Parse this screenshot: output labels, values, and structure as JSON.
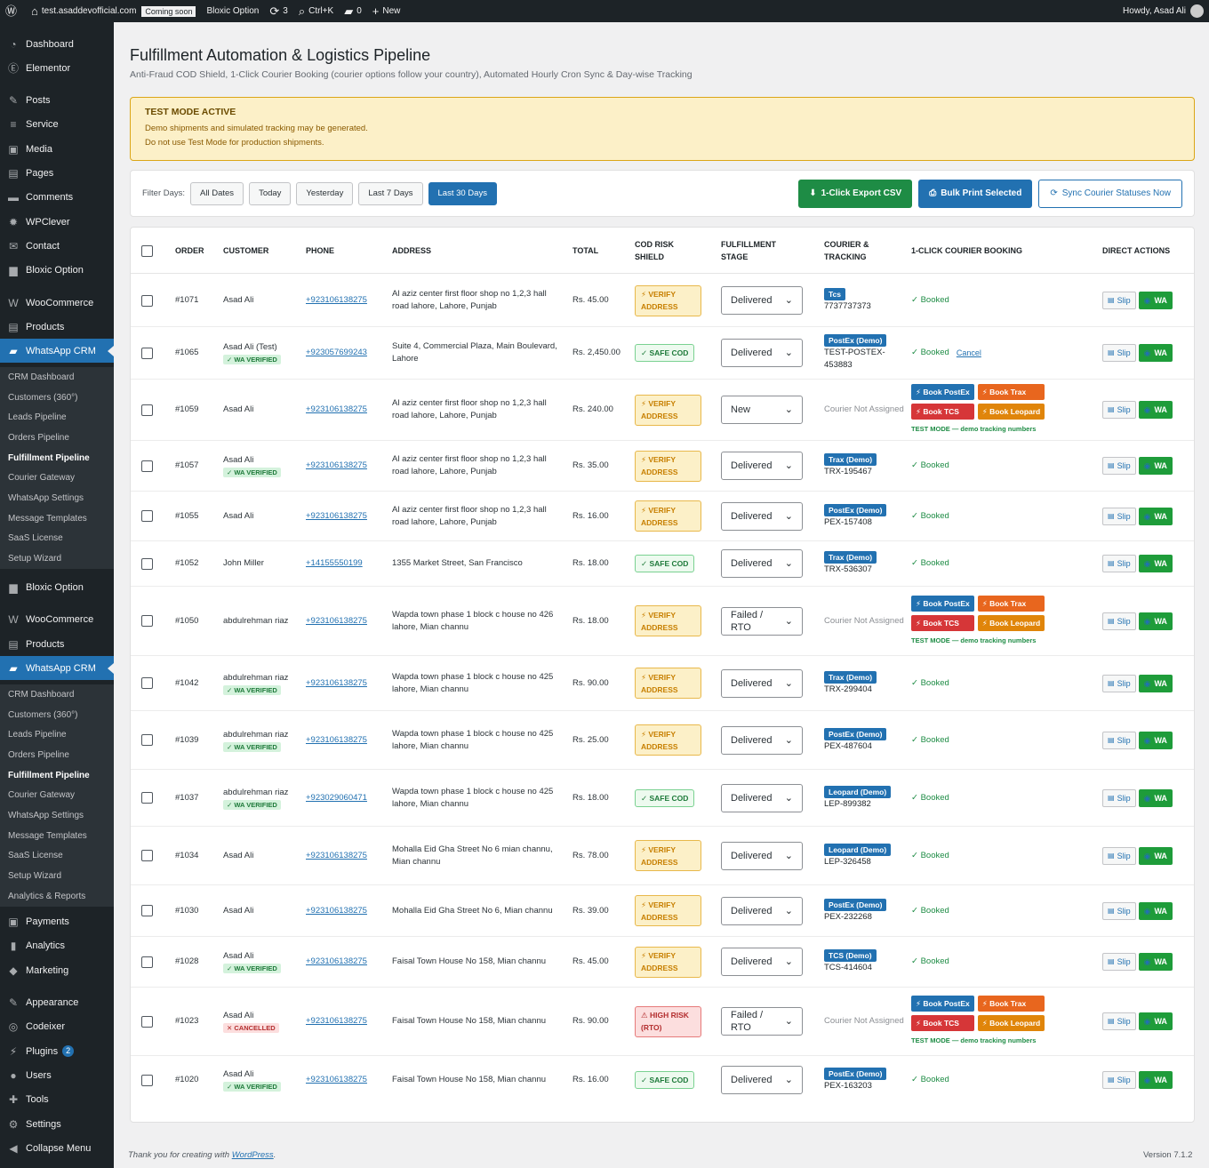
{
  "adminbar": {
    "site": "test.asaddevofficial.com",
    "coming": "Coming soon",
    "plugin": "Bloxic Option",
    "updates": "3",
    "shortcut": "Ctrl+K",
    "comments": "0",
    "new": "New",
    "howdy": "Howdy, Asad Ali"
  },
  "menu": {
    "items": [
      {
        "label": "Dashboard",
        "icon": "dashboard-icon",
        "glyph": "◔"
      },
      {
        "label": "Elementor",
        "icon": "elementor-icon",
        "glyph": "Ⓔ"
      },
      {
        "label": "Posts",
        "icon": "pin-icon",
        "glyph": "✎"
      },
      {
        "label": "Service",
        "icon": "list-icon",
        "glyph": "≡"
      },
      {
        "label": "Media",
        "icon": "media-icon",
        "glyph": "▣"
      },
      {
        "label": "Pages",
        "icon": "pages-icon",
        "glyph": "▤"
      },
      {
        "label": "Comments",
        "icon": "comment-icon",
        "glyph": "▬"
      },
      {
        "label": "WPClever",
        "icon": "gear-icon",
        "glyph": "✹"
      },
      {
        "label": "Contact",
        "icon": "mail-icon",
        "glyph": "✉"
      },
      {
        "label": "Bloxic Option",
        "icon": "folder-icon",
        "glyph": "▆"
      },
      {
        "label": "WooCommerce",
        "icon": "woo-icon",
        "glyph": "W"
      },
      {
        "label": "Products",
        "icon": "archive-icon",
        "glyph": "▤"
      },
      {
        "label": "WhatsApp CRM",
        "icon": "chat-icon",
        "glyph": "▰"
      },
      {
        "label": "Bloxic Option",
        "icon": "folder-icon",
        "glyph": "▆"
      },
      {
        "label": "WooCommerce",
        "icon": "woo-icon",
        "glyph": "W"
      },
      {
        "label": "Products",
        "icon": "archive-icon",
        "glyph": "▤"
      },
      {
        "label": "WhatsApp CRM",
        "icon": "chat-icon",
        "glyph": "▰"
      },
      {
        "label": "Payments",
        "icon": "payments-icon",
        "glyph": "▣"
      },
      {
        "label": "Analytics",
        "icon": "analytics-icon",
        "glyph": "▮"
      },
      {
        "label": "Marketing",
        "icon": "megaphone-icon",
        "glyph": "◆"
      },
      {
        "label": "Appearance",
        "icon": "brush-icon",
        "glyph": "✎"
      },
      {
        "label": "Codeixer",
        "icon": "codeixer-icon",
        "glyph": "◎"
      },
      {
        "label": "Plugins",
        "icon": "plugin-icon",
        "glyph": "⚡",
        "badge": "2"
      },
      {
        "label": "Users",
        "icon": "user-icon",
        "glyph": "●"
      },
      {
        "label": "Tools",
        "icon": "wrench-icon",
        "glyph": "✚"
      },
      {
        "label": "Settings",
        "icon": "settings-icon",
        "glyph": "⚙"
      },
      {
        "label": "Collapse Menu",
        "icon": "collapse-icon",
        "glyph": "◀"
      }
    ],
    "sub1": [
      "CRM Dashboard",
      "Customers (360°)",
      "Leads Pipeline",
      "Orders Pipeline",
      "Fulfillment Pipeline",
      "Courier Gateway",
      "WhatsApp Settings",
      "Message Templates",
      "SaaS License",
      "Setup Wizard"
    ],
    "sub2": [
      "CRM Dashboard",
      "Customers (360°)",
      "Leads Pipeline",
      "Orders Pipeline",
      "Fulfillment Pipeline",
      "Courier Gateway",
      "WhatsApp Settings",
      "Message Templates",
      "SaaS License",
      "Setup Wizard",
      "Analytics & Reports"
    ]
  },
  "page": {
    "title": "Fulfillment Automation & Logistics Pipeline",
    "subtitle": "Anti-Fraud COD Shield, 1-Click Courier Booking (courier options follow your country), Automated Hourly Cron Sync & Day-wise Tracking"
  },
  "notice": {
    "title": "TEST MODE ACTIVE",
    "line1": "Demo shipments and simulated tracking may be generated.",
    "line2": "Do not use Test Mode for production shipments."
  },
  "filters": {
    "label": "Filter Days:",
    "options": [
      "All Dates",
      "Today",
      "Yesterday",
      "Last 7 Days",
      "Last 30 Days"
    ],
    "active": "Last 30 Days"
  },
  "actions": {
    "export": "1-Click Export CSV",
    "print": "Bulk Print Selected",
    "sync": "Sync Courier Statuses Now"
  },
  "table": {
    "headers": {
      "order": "ORDER",
      "customer": "CUSTOMER",
      "phone": "PHONE",
      "address": "ADDRESS",
      "total": "TOTAL",
      "risk1": "COD RISK",
      "risk2": "SHIELD",
      "stage1": "FULFILLMENT",
      "stage2": "STAGE",
      "courier1": "COURIER &",
      "courier2": "TRACKING",
      "booking": "1-CLICK COURIER BOOKING",
      "actions": "DIRECT ACTIONS"
    },
    "labels": {
      "verified": "✓ WA VERIFIED",
      "cancelled": "✕ CANCELLED",
      "booked": "✓ Booked",
      "cancel": "Cancel",
      "not_assigned": "Courier Not Assigned",
      "postex": "⚡ Book PostEx",
      "trax": "⚡ Book Trax",
      "tcs": "⚡ Book TCS",
      "leopard": "⚡ Book Leopard",
      "testmode": "TEST MODE — demo tracking numbers",
      "slip": "Slip",
      "wa": "WA"
    },
    "rows": [
      {
        "order": "#1071",
        "customer": "Asad Ali",
        "badge": "",
        "phone": "+923106138275",
        "address": "Al aziz center first floor shop no 1,2,3 hall road lahore, Lahore, Punjab",
        "total": "Rs. 45.00",
        "risk": "verify",
        "risk_text": "⚡ VERIFY ADDRESS",
        "stage": "Delivered",
        "courier": "Tcs",
        "tracking": "7737737373",
        "booking": "booked"
      },
      {
        "order": "#1065",
        "customer": "Asad Ali (Test)",
        "badge": "verified",
        "phone": "+923057699243",
        "address": "Suite 4, Commercial Plaza, Main Boulevard, Lahore",
        "total": "Rs. 2,450.00",
        "risk": "safe",
        "risk_text": "✓ SAFE COD",
        "stage": "Delivered",
        "courier": "PostEx (Demo)",
        "tracking": "TEST-POSTEX-453883",
        "booking": "booked_cancel"
      },
      {
        "order": "#1059",
        "customer": "Asad Ali",
        "badge": "",
        "phone": "+923106138275",
        "address": "Al aziz center first floor shop no 1,2,3 hall road lahore, Lahore, Punjab",
        "total": "Rs. 240.00",
        "risk": "verify",
        "risk_text": "⚡ VERIFY ADDRESS",
        "stage": "New",
        "courier": "",
        "tracking": "",
        "booking": "book"
      },
      {
        "order": "#1057",
        "customer": "Asad Ali",
        "badge": "verified",
        "phone": "+923106138275",
        "address": "Al aziz center first floor shop no 1,2,3 hall road lahore, Lahore, Punjab",
        "total": "Rs. 35.00",
        "risk": "verify",
        "risk_text": "⚡ VERIFY ADDRESS",
        "stage": "Delivered",
        "courier": "Trax (Demo)",
        "tracking": "TRX-195467",
        "booking": "booked"
      },
      {
        "order": "#1055",
        "customer": "Asad Ali",
        "badge": "",
        "phone": "+923106138275",
        "address": "Al aziz center first floor shop no 1,2,3 hall road lahore, Lahore, Punjab",
        "total": "Rs. 16.00",
        "risk": "verify",
        "risk_text": "⚡ VERIFY ADDRESS",
        "stage": "Delivered",
        "courier": "PostEx (Demo)",
        "tracking": "PEX-157408",
        "booking": "booked"
      },
      {
        "order": "#1052",
        "customer": "John Miller",
        "badge": "",
        "phone": "+14155550199",
        "address": "1355 Market Street, San Francisco",
        "total": "Rs. 18.00",
        "risk": "safe",
        "risk_text": "✓ SAFE COD",
        "stage": "Delivered",
        "courier": "Trax (Demo)",
        "tracking": "TRX-536307",
        "booking": "booked"
      },
      {
        "order": "#1050",
        "customer": "abdulrehman riaz",
        "badge": "",
        "phone": "+923106138275",
        "address": "Wapda town phase 1 block c house no 426 lahore, Mian channu",
        "total": "Rs. 18.00",
        "risk": "verify",
        "risk_text": "⚡ VERIFY ADDRESS",
        "stage": "Failed / RTO",
        "courier": "",
        "tracking": "",
        "booking": "book"
      },
      {
        "order": "#1042",
        "customer": "abdulrehman riaz",
        "badge": "verified",
        "phone": "+923106138275",
        "address": "Wapda town phase 1 block c house no 425 lahore, Mian channu",
        "total": "Rs. 90.00",
        "risk": "verify",
        "risk_text": "⚡ VERIFY ADDRESS",
        "stage": "Delivered",
        "courier": "Trax (Demo)",
        "tracking": "TRX-299404",
        "booking": "booked"
      },
      {
        "order": "#1039",
        "customer": "abdulrehman riaz",
        "badge": "verified",
        "phone": "+923106138275",
        "address": "Wapda town phase 1 block c house no 425 lahore, Mian channu",
        "total": "Rs. 25.00",
        "risk": "verify",
        "risk_text": "⚡ VERIFY ADDRESS",
        "stage": "Delivered",
        "courier": "PostEx (Demo)",
        "tracking": "PEX-487604",
        "booking": "booked"
      },
      {
        "order": "#1037",
        "customer": "abdulrehman riaz",
        "badge": "verified",
        "phone": "+923029060471",
        "address": "Wapda town phase 1 block c house no 425 lahore, Mian channu",
        "total": "Rs. 18.00",
        "risk": "safe",
        "risk_text": "✓ SAFE COD",
        "stage": "Delivered",
        "courier": "Leopard (Demo)",
        "tracking": "LEP-899382",
        "booking": "booked"
      },
      {
        "order": "#1034",
        "customer": "Asad Ali",
        "badge": "",
        "phone": "+923106138275",
        "address": "Mohalla Eid Gha Street No 6 mian channu, Mian channu",
        "total": "Rs. 78.00",
        "risk": "verify",
        "risk_text": "⚡ VERIFY ADDRESS",
        "stage": "Delivered",
        "courier": "Leopard (Demo)",
        "tracking": "LEP-326458",
        "booking": "booked"
      },
      {
        "order": "#1030",
        "customer": "Asad Ali",
        "badge": "",
        "phone": "+923106138275",
        "address": "Mohalla Eid Gha Street No 6, Mian channu",
        "total": "Rs. 39.00",
        "risk": "verify",
        "risk_text": "⚡ VERIFY ADDRESS",
        "stage": "Delivered",
        "courier": "PostEx (Demo)",
        "tracking": "PEX-232268",
        "booking": "booked"
      },
      {
        "order": "#1028",
        "customer": "Asad Ali",
        "badge": "verified",
        "phone": "+923106138275",
        "address": "Faisal Town House No 158, Mian channu",
        "total": "Rs. 45.00",
        "risk": "verify",
        "risk_text": "⚡ VERIFY ADDRESS",
        "stage": "Delivered",
        "courier": "TCS (Demo)",
        "tracking": "TCS-414604",
        "booking": "booked"
      },
      {
        "order": "#1023",
        "customer": "Asad Ali",
        "badge": "cancelled",
        "phone": "+923106138275",
        "address": "Faisal Town House No 158, Mian channu",
        "total": "Rs. 90.00",
        "risk": "high",
        "risk_text": "⚠ HIGH RISK (RTO)",
        "stage": "Failed / RTO",
        "courier": "",
        "tracking": "",
        "booking": "book"
      },
      {
        "order": "#1020",
        "customer": "Asad Ali",
        "badge": "verified",
        "phone": "+923106138275",
        "address": "Faisal Town House No 158, Mian channu",
        "total": "Rs. 16.00",
        "risk": "safe",
        "risk_text": "✓ SAFE COD",
        "stage": "Delivered",
        "courier": "PostEx (Demo)",
        "tracking": "PEX-163203",
        "booking": "booked"
      }
    ]
  },
  "footer": {
    "thanks": "Thank you for creating with",
    "wp": "WordPress",
    "version": "Version 7.1.2"
  }
}
